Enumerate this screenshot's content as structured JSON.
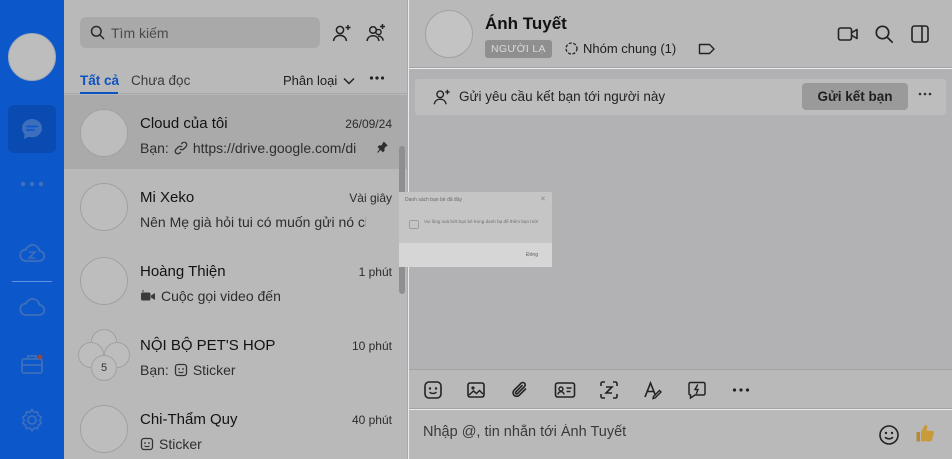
{
  "sidebar": {
    "icons": [
      "avatar",
      "chat-icon",
      "more-icon",
      "cloud-z-icon",
      "cloud-icon",
      "briefcase-icon",
      "gear-icon"
    ]
  },
  "search": {
    "placeholder": "Tìm kiếm"
  },
  "filters": {
    "tab_all": "Tất cả",
    "tab_unread": "Chưa đọc",
    "classify": "Phân loại"
  },
  "conversations": [
    {
      "name": "Cloud của tôi",
      "time": "26/09/24",
      "preview_prefix": "Bạn:",
      "preview": "https://drive.google.com/di",
      "pinned": true
    },
    {
      "name": "Mi Xeko",
      "time": "Vài giây",
      "preview": "Nên Mẹ già hỏi tui có muốn gửi nó cho"
    },
    {
      "name": "Hoàng Thiện",
      "time": "1 phút",
      "preview": "Cuộc gọi video đến"
    },
    {
      "name": "NỘI BỘ PET'S HOP",
      "time": "10 phút",
      "preview_prefix": "Bạn:",
      "preview": "Sticker",
      "member_count": "5"
    },
    {
      "name": "Chi-Thẩm Quy",
      "time": "40 phút",
      "preview": "Sticker"
    }
  ],
  "chat": {
    "contact_name": "Ánh Tuyết",
    "badge": "NGƯỜI LẠ",
    "common_groups": "Nhóm chung (1)",
    "friend_bar_text": "Gửi yêu cầu kết bạn tới người này",
    "friend_button": "Gửi kết bạn",
    "input_placeholder": "Nhập @, tin nhắn tới Ánh Tuyết"
  },
  "dialog": {
    "title": "Danh sách bạn bè đã đầy",
    "message": "Vui lòng xoá bớt bạn bè trong danh bạ để thêm bạn mới",
    "button": "Đóng"
  },
  "colors": {
    "rail": "#0c57c9",
    "accent": "#0b52c2",
    "overlay_gray": "#b9b9b9"
  }
}
